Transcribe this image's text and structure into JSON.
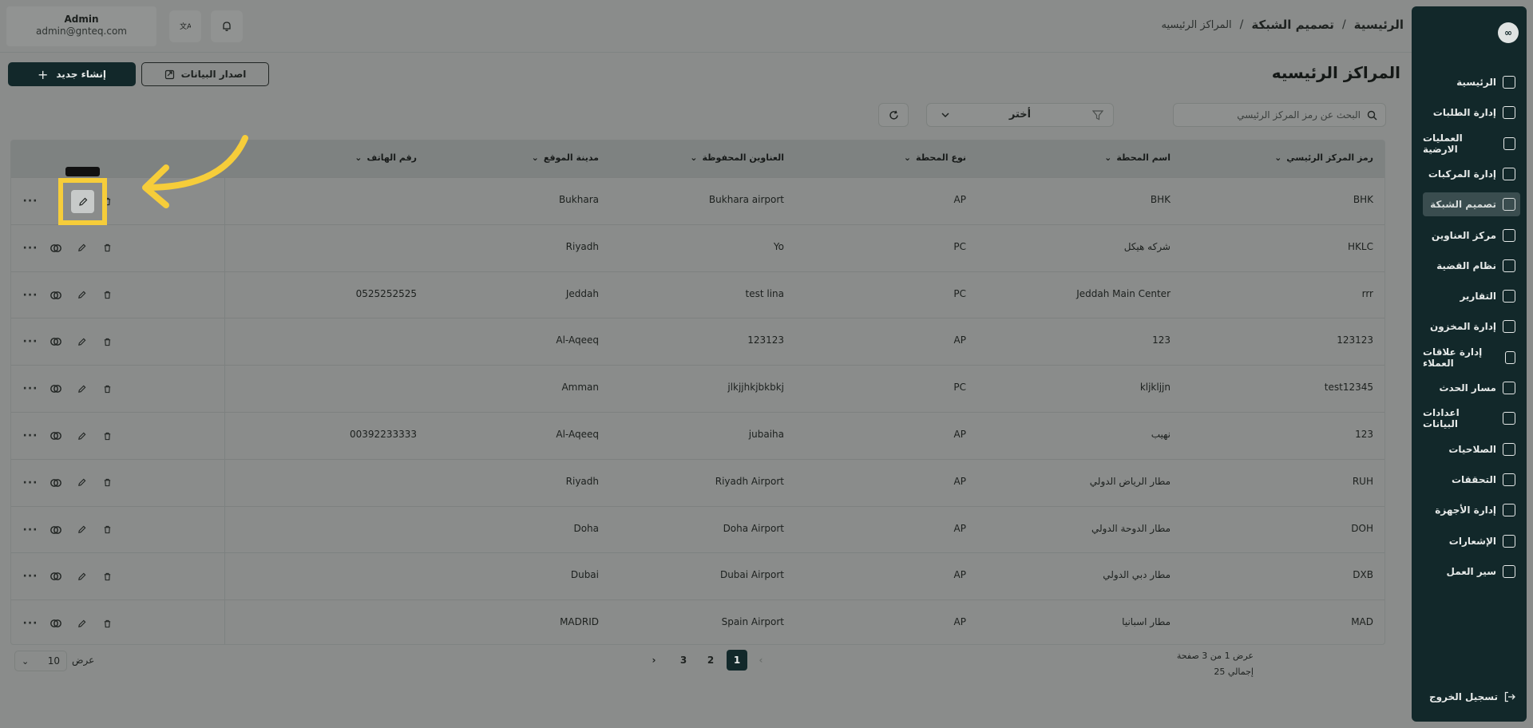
{
  "user": {
    "name": "Admin",
    "email": "admin@gnteq.com"
  },
  "breadcrumb": {
    "home": "الرئيسية",
    "section": "تصميم الشبكة",
    "current": "المراكز الرئيسيه",
    "sep": "/"
  },
  "page_title": "المراكز الرئيسيه",
  "buttons": {
    "create": "إنشاء جديد",
    "export": "اصدار البيانات"
  },
  "search": {
    "placeholder": "البحث عن رمز المركز الرئيسي"
  },
  "filter": {
    "label": "أختر"
  },
  "table": {
    "headers": [
      "رمز المركز الرئيسي",
      "اسم المحطة",
      "نوع المحطة",
      "العناوين المحفوظة",
      "مدينة الموقع",
      "رقم الهاتف"
    ],
    "rows": [
      {
        "code": "BHK",
        "name": "BHK",
        "type": "AP",
        "address": "Bukhara airport",
        "city": "Bukhara",
        "phone": ""
      },
      {
        "code": "HKLC",
        "name": "شركه هيكل",
        "type": "PC",
        "address": "Yo",
        "city": "Riyadh",
        "phone": ""
      },
      {
        "code": "rrr",
        "name": "Jeddah Main Center",
        "type": "PC",
        "address": "test lina",
        "city": "Jeddah",
        "phone": "0525252525"
      },
      {
        "code": "123123",
        "name": "123",
        "type": "AP",
        "address": "123123",
        "city": "Al-Aqeeq",
        "phone": ""
      },
      {
        "code": "test12345",
        "name": "kljkljjn",
        "type": "PC",
        "address": "jlkjjhkjbkbkj",
        "city": "Amman",
        "phone": ""
      },
      {
        "code": "123",
        "name": "نهيب",
        "type": "AP",
        "address": "jubaiha",
        "city": "Al-Aqeeq",
        "phone": "00392233333"
      },
      {
        "code": "RUH",
        "name": "مطار الرياض الدولي",
        "type": "AP",
        "address": "Riyadh Airport",
        "city": "Riyadh",
        "phone": ""
      },
      {
        "code": "DOH",
        "name": "مطار الدوحة الدولي",
        "type": "AP",
        "address": "Doha Airport",
        "city": "Doha",
        "phone": ""
      },
      {
        "code": "DXB",
        "name": "مطار دبي الدولي",
        "type": "AP",
        "address": "Dubai Airport",
        "city": "Dubai",
        "phone": ""
      },
      {
        "code": "MAD",
        "name": "مطار اسبانيا",
        "type": "AP",
        "address": "Spain Airport",
        "city": "MADRID",
        "phone": ""
      }
    ]
  },
  "pagination": {
    "pages": [
      "1",
      "2",
      "3"
    ],
    "active": "1",
    "summary": "عرض 1 من 3 صفحة",
    "total": "إجمالي 25",
    "page_size_label": "عرض",
    "page_size": "10"
  },
  "sidebar": {
    "items": [
      {
        "label": "الرئيسية",
        "icon": "dashboard-icon"
      },
      {
        "label": "إدارة الطلبات",
        "icon": "orders-icon"
      },
      {
        "label": "العمليات الارضية",
        "icon": "ground-ops-icon"
      },
      {
        "label": "إدارة المركبات",
        "icon": "truck-icon"
      },
      {
        "label": "تصميم الشبكة",
        "icon": "network-icon",
        "active": true
      },
      {
        "label": "مركز العناوين",
        "icon": "location-icon"
      },
      {
        "label": "نظام القضية",
        "icon": "case-icon"
      },
      {
        "label": "التقارير",
        "icon": "reports-icon"
      },
      {
        "label": "إدارة المخزون",
        "icon": "inventory-icon"
      },
      {
        "label": "إدارة علاقات العملاء",
        "icon": "crm-icon"
      },
      {
        "label": "مسار الحدث",
        "icon": "route-icon"
      },
      {
        "label": "اعدادات البيانات",
        "icon": "database-icon"
      },
      {
        "label": "الصلاحيات",
        "icon": "users-icon"
      },
      {
        "label": "التحققات",
        "icon": "tools-icon"
      },
      {
        "label": "إدارة الأجهزة",
        "icon": "devices-icon"
      },
      {
        "label": "الإشعارات",
        "icon": "bell-icon"
      },
      {
        "label": "سير العمل",
        "icon": "workflow-icon"
      }
    ],
    "logout": "تسجيل الخروج"
  },
  "colors": {
    "accent": "#12282a",
    "highlight": "#f6cd3a",
    "overlay": "#8a8c8b"
  }
}
